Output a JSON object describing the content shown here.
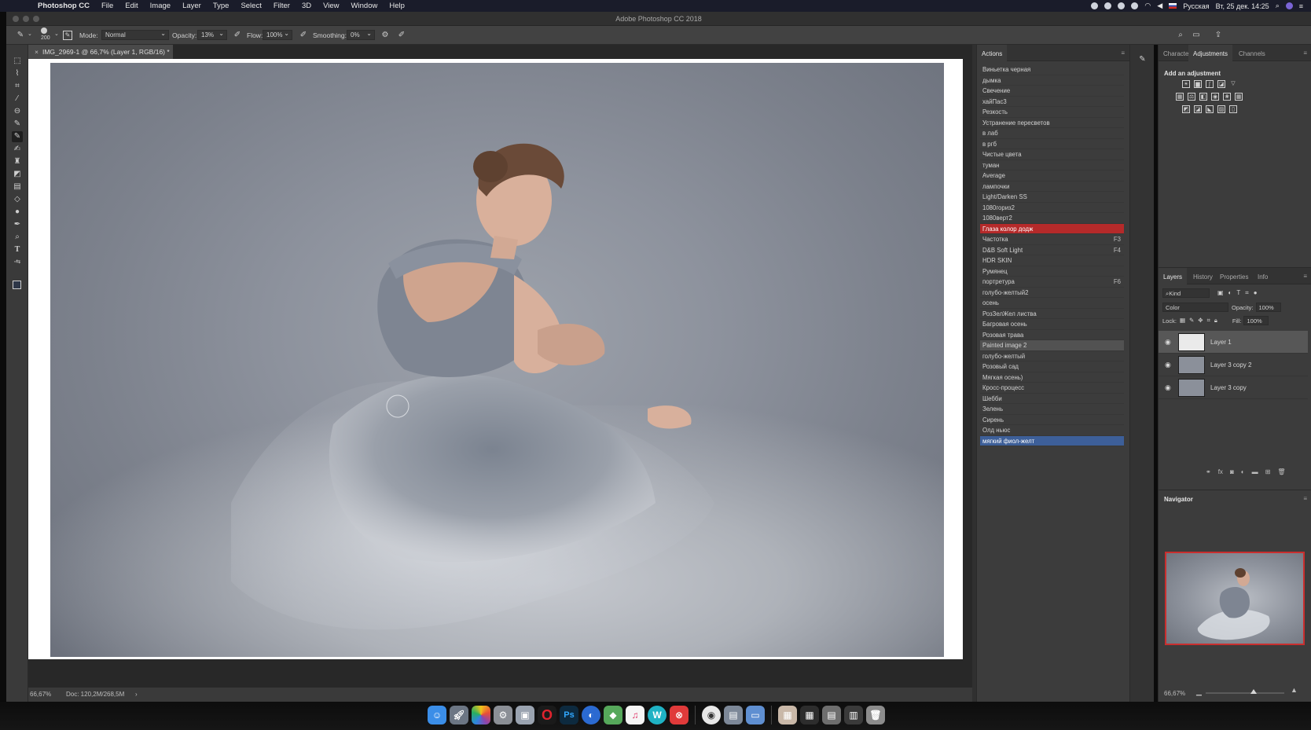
{
  "menubar": {
    "apple": "",
    "app_name": "Photoshop CC",
    "menus": [
      "File",
      "Edit",
      "Image",
      "Layer",
      "Type",
      "Select",
      "Filter",
      "3D",
      "View",
      "Window",
      "Help"
    ],
    "input_source": "Русская",
    "datetime": "Вт, 25 дек. 14:25"
  },
  "window": {
    "title": "Adobe Photoshop CC 2018"
  },
  "options": {
    "brush_size": "200",
    "mode_label": "Mode:",
    "mode_value": "Normal",
    "opacity_label": "Opacity:",
    "opacity_value": "13%",
    "flow_label": "Flow:",
    "flow_value": "100%",
    "smoothing_label": "Smoothing:",
    "smoothing_value": "0%"
  },
  "document": {
    "tab_title": "IMG_2969-1 @ 66,7% (Layer 1, RGB/16) *",
    "zoom": "66,67%",
    "doc_size": "Doc: 120,2M/268,5M"
  },
  "actions_panel": {
    "tab": "Actions",
    "items": [
      {
        "label": "Виньетка черная",
        "key": ""
      },
      {
        "label": "дымка",
        "key": ""
      },
      {
        "label": "Свечение",
        "key": ""
      },
      {
        "label": "хайПас3",
        "key": ""
      },
      {
        "label": "Резкость",
        "key": ""
      },
      {
        "label": "Устранение пересветов",
        "key": ""
      },
      {
        "label": "в лаб",
        "key": ""
      },
      {
        "label": "в ргб",
        "key": ""
      },
      {
        "label": "Чистые цвета",
        "key": ""
      },
      {
        "label": "туман",
        "key": ""
      },
      {
        "label": "Average",
        "key": ""
      },
      {
        "label": "лампочки",
        "key": ""
      },
      {
        "label": "Light/Darken SS",
        "key": ""
      },
      {
        "label": "1080гориз2",
        "key": ""
      },
      {
        "label": "1080верт2",
        "key": ""
      },
      {
        "label": "Глаза колор додж",
        "key": "",
        "state": "red"
      },
      {
        "label": "Частотка",
        "key": "F3"
      },
      {
        "label": "D&B Soft Light",
        "key": "F4"
      },
      {
        "label": "HDR SKIN",
        "key": ""
      },
      {
        "label": "Румянец",
        "key": ""
      },
      {
        "label": "портретура",
        "key": "F6"
      },
      {
        "label": "голубо-желтый2",
        "key": ""
      },
      {
        "label": "осень",
        "key": ""
      },
      {
        "label": "РозЗелЖел листва",
        "key": ""
      },
      {
        "label": "Багровая осень",
        "key": ""
      },
      {
        "label": "Розовая трава",
        "key": ""
      },
      {
        "label": "Painted image 2",
        "key": "",
        "state": "grey"
      },
      {
        "label": "голубо-желтый",
        "key": ""
      },
      {
        "label": "Розовый сад",
        "key": ""
      },
      {
        "label": "Мягкая осень)",
        "key": ""
      },
      {
        "label": "Кросс-процесс",
        "key": ""
      },
      {
        "label": "Шебби",
        "key": ""
      },
      {
        "label": "Зелень",
        "key": ""
      },
      {
        "label": "Сирень",
        "key": ""
      },
      {
        "label": "Олд ньюс",
        "key": ""
      },
      {
        "label": "мягкий фиол-желт",
        "key": "",
        "state": "blue"
      }
    ]
  },
  "adjustments_panel": {
    "tabs": [
      "Character",
      "Adjustments",
      "Channels"
    ],
    "active_tab": "Adjustments",
    "heading": "Add an adjustment"
  },
  "layers_panel": {
    "tabs": [
      "Layers",
      "History",
      "Properties",
      "Info"
    ],
    "filter_label": "Kind",
    "blend_mode": "Color",
    "opacity_label": "Opacity:",
    "opacity_value": "100%",
    "lock_label": "Lock:",
    "fill_label": "Fill:",
    "fill_value": "100%",
    "layers": [
      {
        "name": "Layer 1",
        "selected": true
      },
      {
        "name": "Layer 3 copy 2",
        "selected": false
      },
      {
        "name": "Layer 3 copy",
        "selected": false
      }
    ]
  },
  "navigator_panel": {
    "title": "Navigator",
    "zoom": "66,67%"
  }
}
